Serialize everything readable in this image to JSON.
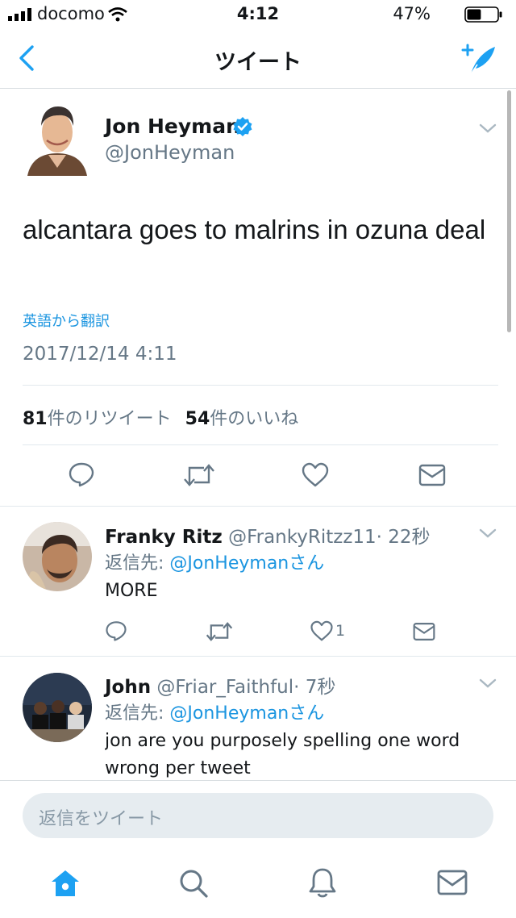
{
  "status_bar": {
    "carrier": "docomo",
    "time": "4:12",
    "battery_percent": "47%",
    "battery_level": 0.47
  },
  "nav": {
    "title": "ツイート",
    "back_icon": "chevron-left-icon",
    "compose_icon": "compose-tweet-icon"
  },
  "tweet": {
    "author_name": "Jon Heyman",
    "author_handle": "@JonHeyman",
    "verified": true,
    "text": "alcantara goes to malrins in ozuna deal",
    "translate_link": "英語から翻訳",
    "timestamp": "2017/12/14 4:11",
    "retweet_count": "81",
    "retweet_label": "件のリツイート",
    "like_count": "54",
    "like_label": "件のいいね",
    "actions": [
      "reply-icon",
      "retweet-icon",
      "like-icon",
      "message-icon"
    ]
  },
  "replies": [
    {
      "name": "Franky Ritz",
      "handle": "@FrankyRitzz11",
      "time": "· 22秒",
      "reply_to_prefix": "返信先: ",
      "reply_to_handle": "@JonHeymanさん",
      "text": "MORE",
      "like_count": "1"
    },
    {
      "name": "John",
      "handle": "@Friar_Faithful",
      "time": "· 7秒",
      "reply_to_prefix": "返信先: ",
      "reply_to_handle": "@JonHeymanさん",
      "text": "jon are you purposely spelling one word wrong per tweet"
    }
  ],
  "reply_box": {
    "placeholder": "返信をツイート"
  },
  "tab_bar": {
    "items": [
      "home-icon",
      "search-icon",
      "notifications-icon",
      "messages-icon"
    ],
    "active": "home-icon",
    "accent": "#1da1f2"
  }
}
